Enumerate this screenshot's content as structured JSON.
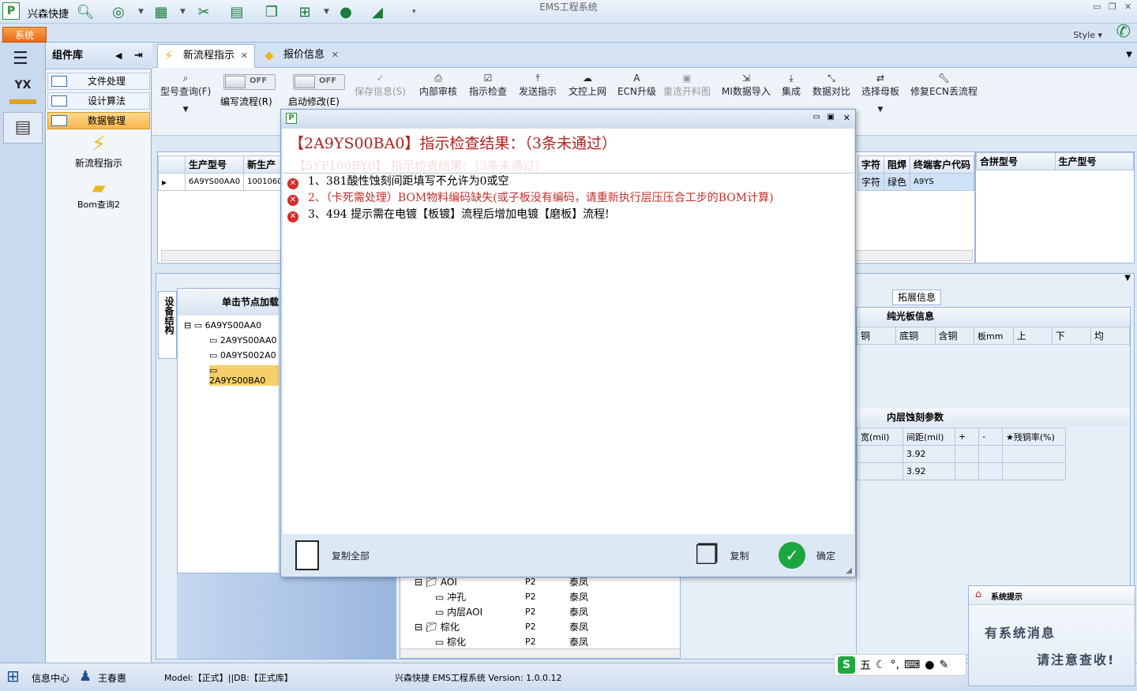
{
  "app": {
    "name": "兴森快捷",
    "title": "EMS工程系统",
    "system_tab": "系统",
    "style_label": "Style"
  },
  "comp": {
    "title": "组件库",
    "items": [
      "文件处理",
      "设计算法",
      "数据管理"
    ],
    "tools": [
      "新流程指示",
      "Bom查询2"
    ]
  },
  "tabs": [
    {
      "label": "新流程指示"
    },
    {
      "label": "报价信息"
    }
  ],
  "toolbar": {
    "items": [
      "型号查询(F)",
      "保存信息(S)",
      "内部审核",
      "指示检查",
      "发送指示",
      "文控上网",
      "ECN升级",
      "重选开料图",
      "MI数据导入",
      "集成",
      "数据对比",
      "选择母板",
      "修复ECN丢流程"
    ],
    "toggle1": "编写流程(R)",
    "toggle2": "启动修改(E)",
    "off": "OFF"
  },
  "grid": {
    "cols": [
      "生产型号",
      "新生产"
    ],
    "row": [
      "6A9YS00AA0",
      "10010600"
    ],
    "right_cols": [
      "字符",
      "阻焊",
      "终端客户代码"
    ],
    "right_row": [
      "字符",
      "绿色",
      "A9YS"
    ],
    "side_cols": [
      "合拼型号",
      "生产型号"
    ]
  },
  "tree": {
    "side_tab": "设备结构",
    "header": "单击节点加载",
    "nodes": [
      "6A9YS00AA0",
      "2A9YS00AA0",
      "0A9YS002A0",
      "2A9YS00BA0"
    ]
  },
  "bottom_tree": {
    "rows": [
      [
        "AOI",
        "P2",
        "泰凤"
      ],
      [
        "冲孔",
        "P2",
        "泰凤"
      ],
      [
        "内层AOI",
        "P2",
        "泰凤"
      ],
      [
        "棕化",
        "P2",
        "泰凤"
      ],
      [
        "棕化",
        "P2",
        "泰凤"
      ]
    ]
  },
  "ext": {
    "tab": "拓展信息",
    "sec1": "纯光板信息",
    "cols1": [
      "铜",
      "底铜",
      "含铜",
      "板mm",
      "上",
      "下",
      "均"
    ],
    "sec2": "内层蚀刻参数",
    "cols2": [
      "宽(mil)",
      "间距(mil)",
      "+",
      "-",
      "★残铜率(%)"
    ],
    "vals": [
      "3.92",
      "3.92"
    ]
  },
  "dialog": {
    "title": "【2A9YS00BA0】指示检查结果：（3条未通过）",
    "shadow": "【5YP100BY0】 指示检查结果：（3条未通过）",
    "messages": [
      "1、381酸性蚀刻间距填写不允许为0或空",
      "2、（卡死需处理）BOM物料编码缺失(或子板没有编码，请重新执行层压压合工步的BOM计算)",
      "3、494 提示需在电镀【板镀】流程后增加电镀【磨板】流程!"
    ],
    "copy_all": "复制全部",
    "copy": "复制",
    "ok": "确定"
  },
  "status": {
    "info": "信息中心",
    "user": "王春惠",
    "model": "Model:【正式】||DB:【正式库】",
    "version": "兴森快捷 EMS工程系统 Version: 1.0.0.12"
  },
  "notify": {
    "title": "系统提示",
    "line1": "有系统消息",
    "line2": "请注意查收!"
  },
  "ime": {
    "mode": "五"
  }
}
